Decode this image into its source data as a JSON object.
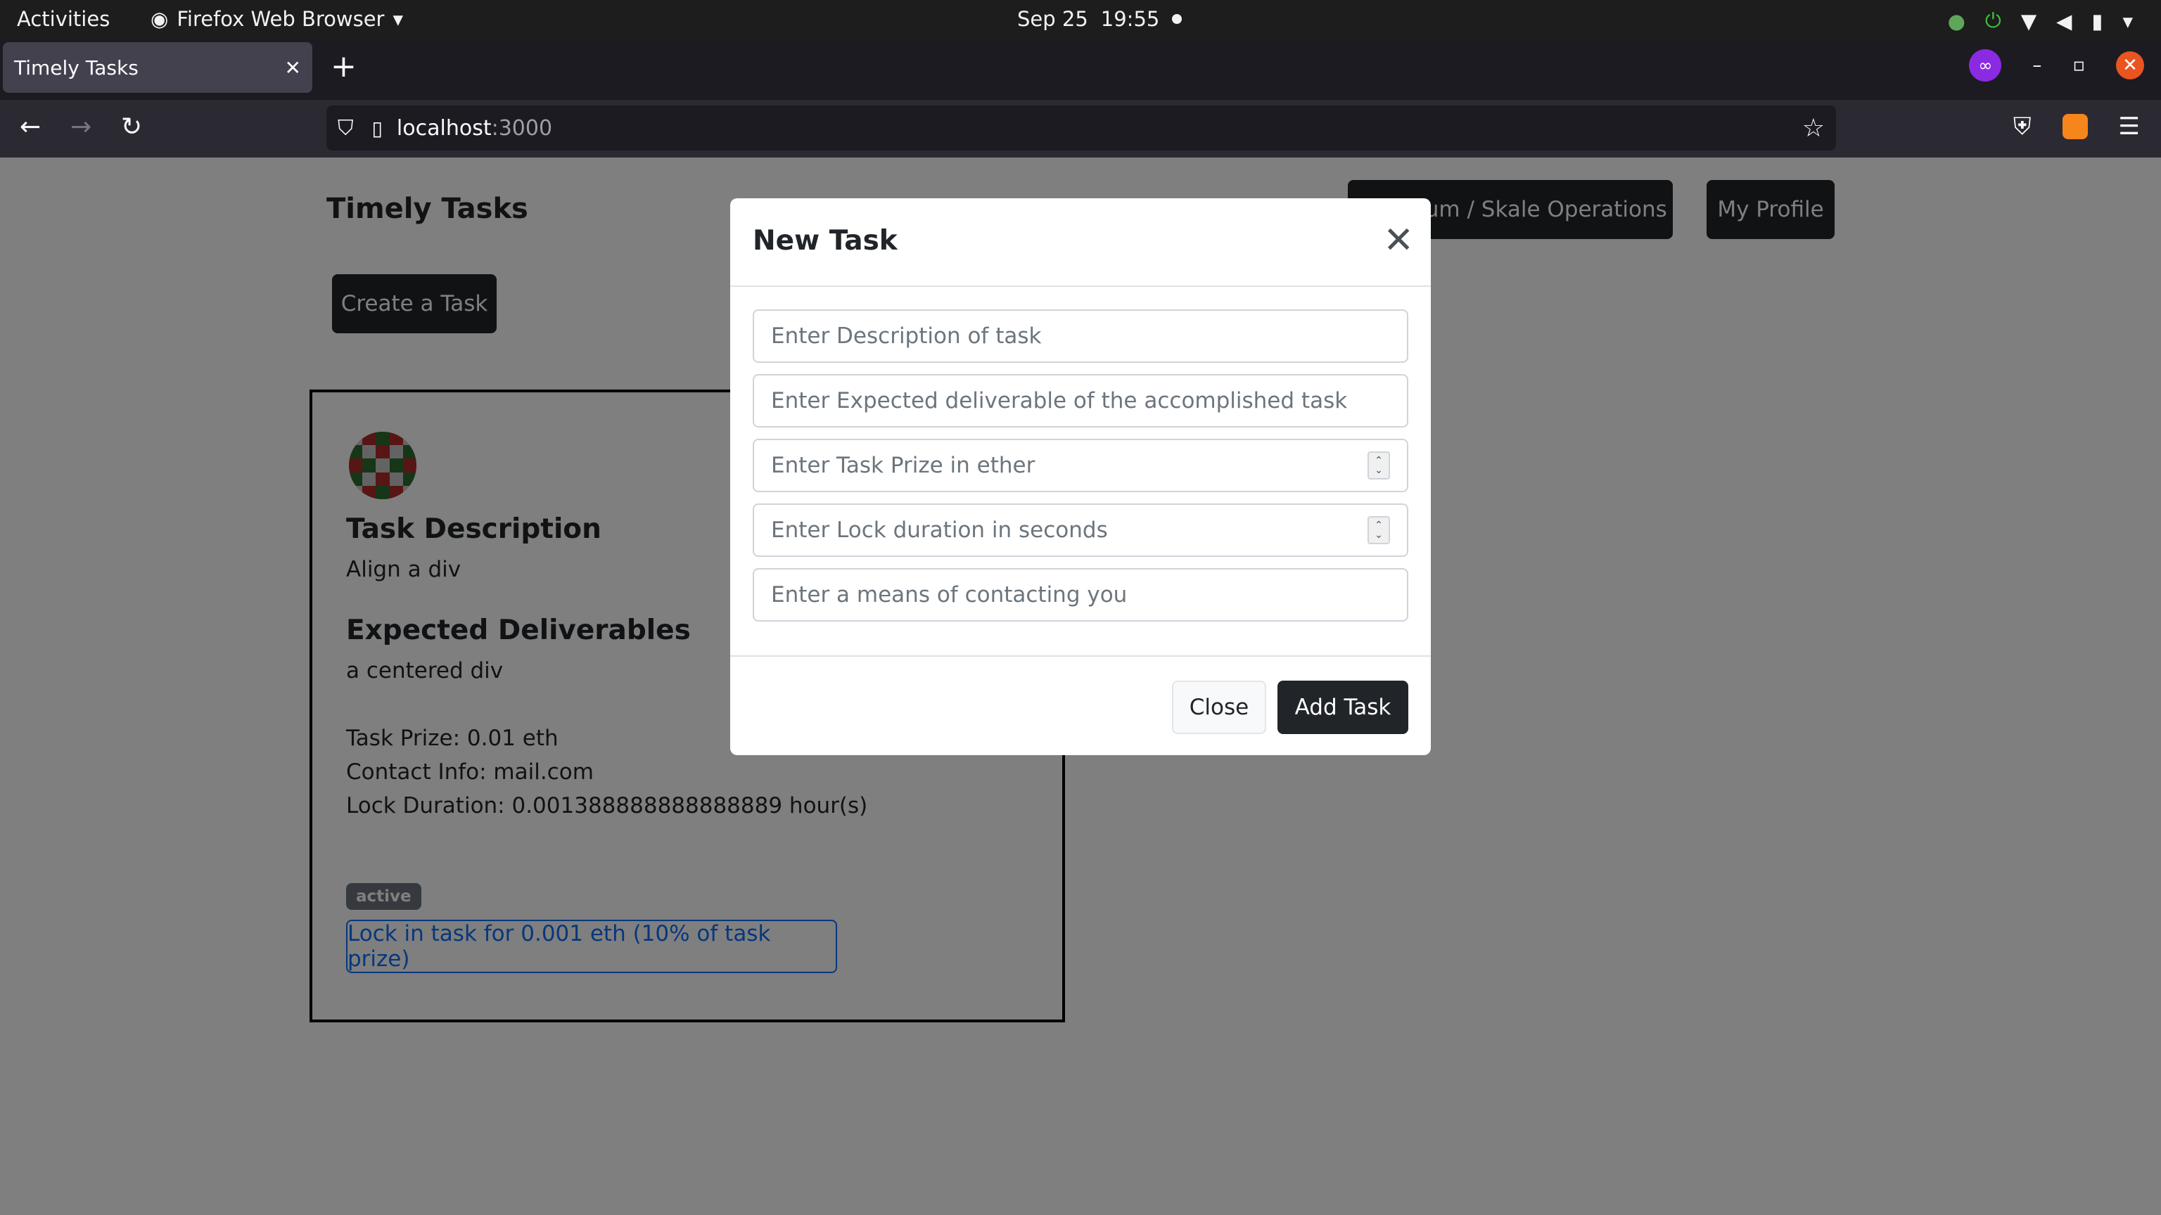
{
  "system_bar": {
    "activities": "Activities",
    "app_name": "Firefox Web Browser",
    "date": "Sep 25",
    "time": "19:55"
  },
  "browser": {
    "tab_title": "Timely Tasks",
    "url_host": "localhost",
    "url_port": ":3000"
  },
  "page": {
    "brand": "Timely Tasks",
    "create_task_label": "Create a Task",
    "operations_label": "Ethereum / Skale Operations",
    "profile_label": "My Profile",
    "task_card": {
      "description_heading": "Task Description",
      "description": "Align a div",
      "deliverables_heading": "Expected Deliverables",
      "deliverables": "a centered div",
      "prize_line": "Task Prize: 0.01 eth",
      "contact_line": "Contact Info: mail.com",
      "lock_duration_line": "Lock Duration: 0.001388888888888889 hour(s)",
      "status_badge": "active",
      "lock_button_label": "Lock in task for 0.001 eth (10% of task prize)"
    }
  },
  "modal": {
    "title": "New Task",
    "fields": {
      "description_placeholder": "Enter Description of task",
      "deliverable_placeholder": "Enter Expected deliverable of the accomplished task",
      "prize_placeholder": "Enter Task Prize in ether",
      "lock_duration_placeholder": "Enter Lock duration in seconds",
      "contact_placeholder": "Enter a means of contacting you"
    },
    "close_label": "Close",
    "add_label": "Add Task"
  },
  "colors": {
    "primary_dark": "#212529",
    "link_blue": "#0d6efd",
    "badge_gray": "#6c757d",
    "firefox_dark": "#1c1b22",
    "ubuntu_orange": "#e95420"
  }
}
